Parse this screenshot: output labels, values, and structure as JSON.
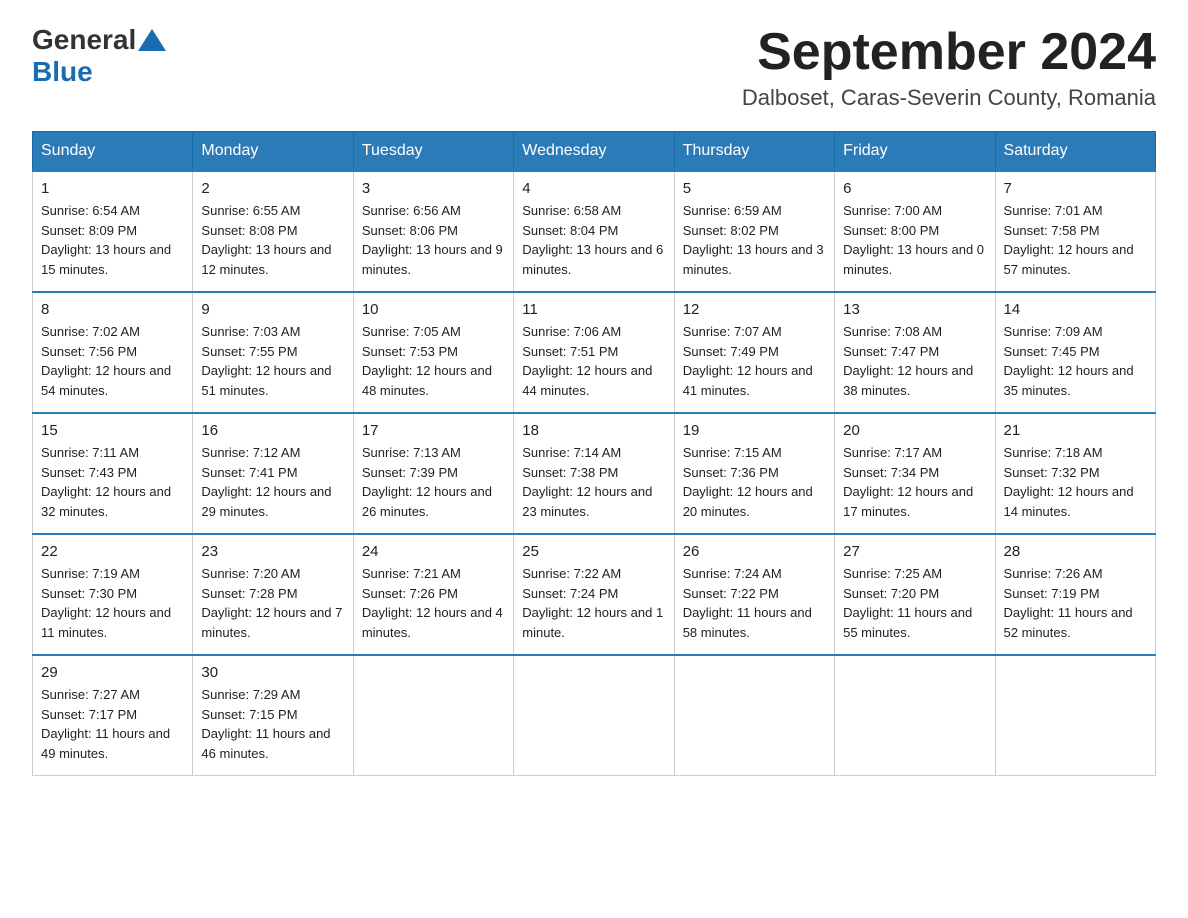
{
  "header": {
    "logo_general": "General",
    "logo_blue": "Blue",
    "month_title": "September 2024",
    "location": "Dalboset, Caras-Severin County, Romania"
  },
  "days_of_week": [
    "Sunday",
    "Monday",
    "Tuesday",
    "Wednesday",
    "Thursday",
    "Friday",
    "Saturday"
  ],
  "weeks": [
    [
      {
        "day": "1",
        "sunrise": "6:54 AM",
        "sunset": "8:09 PM",
        "daylight": "13 hours and 15 minutes."
      },
      {
        "day": "2",
        "sunrise": "6:55 AM",
        "sunset": "8:08 PM",
        "daylight": "13 hours and 12 minutes."
      },
      {
        "day": "3",
        "sunrise": "6:56 AM",
        "sunset": "8:06 PM",
        "daylight": "13 hours and 9 minutes."
      },
      {
        "day": "4",
        "sunrise": "6:58 AM",
        "sunset": "8:04 PM",
        "daylight": "13 hours and 6 minutes."
      },
      {
        "day": "5",
        "sunrise": "6:59 AM",
        "sunset": "8:02 PM",
        "daylight": "13 hours and 3 minutes."
      },
      {
        "day": "6",
        "sunrise": "7:00 AM",
        "sunset": "8:00 PM",
        "daylight": "13 hours and 0 minutes."
      },
      {
        "day": "7",
        "sunrise": "7:01 AM",
        "sunset": "7:58 PM",
        "daylight": "12 hours and 57 minutes."
      }
    ],
    [
      {
        "day": "8",
        "sunrise": "7:02 AM",
        "sunset": "7:56 PM",
        "daylight": "12 hours and 54 minutes."
      },
      {
        "day": "9",
        "sunrise": "7:03 AM",
        "sunset": "7:55 PM",
        "daylight": "12 hours and 51 minutes."
      },
      {
        "day": "10",
        "sunrise": "7:05 AM",
        "sunset": "7:53 PM",
        "daylight": "12 hours and 48 minutes."
      },
      {
        "day": "11",
        "sunrise": "7:06 AM",
        "sunset": "7:51 PM",
        "daylight": "12 hours and 44 minutes."
      },
      {
        "day": "12",
        "sunrise": "7:07 AM",
        "sunset": "7:49 PM",
        "daylight": "12 hours and 41 minutes."
      },
      {
        "day": "13",
        "sunrise": "7:08 AM",
        "sunset": "7:47 PM",
        "daylight": "12 hours and 38 minutes."
      },
      {
        "day": "14",
        "sunrise": "7:09 AM",
        "sunset": "7:45 PM",
        "daylight": "12 hours and 35 minutes."
      }
    ],
    [
      {
        "day": "15",
        "sunrise": "7:11 AM",
        "sunset": "7:43 PM",
        "daylight": "12 hours and 32 minutes."
      },
      {
        "day": "16",
        "sunrise": "7:12 AM",
        "sunset": "7:41 PM",
        "daylight": "12 hours and 29 minutes."
      },
      {
        "day": "17",
        "sunrise": "7:13 AM",
        "sunset": "7:39 PM",
        "daylight": "12 hours and 26 minutes."
      },
      {
        "day": "18",
        "sunrise": "7:14 AM",
        "sunset": "7:38 PM",
        "daylight": "12 hours and 23 minutes."
      },
      {
        "day": "19",
        "sunrise": "7:15 AM",
        "sunset": "7:36 PM",
        "daylight": "12 hours and 20 minutes."
      },
      {
        "day": "20",
        "sunrise": "7:17 AM",
        "sunset": "7:34 PM",
        "daylight": "12 hours and 17 minutes."
      },
      {
        "day": "21",
        "sunrise": "7:18 AM",
        "sunset": "7:32 PM",
        "daylight": "12 hours and 14 minutes."
      }
    ],
    [
      {
        "day": "22",
        "sunrise": "7:19 AM",
        "sunset": "7:30 PM",
        "daylight": "12 hours and 11 minutes."
      },
      {
        "day": "23",
        "sunrise": "7:20 AM",
        "sunset": "7:28 PM",
        "daylight": "12 hours and 7 minutes."
      },
      {
        "day": "24",
        "sunrise": "7:21 AM",
        "sunset": "7:26 PM",
        "daylight": "12 hours and 4 minutes."
      },
      {
        "day": "25",
        "sunrise": "7:22 AM",
        "sunset": "7:24 PM",
        "daylight": "12 hours and 1 minute."
      },
      {
        "day": "26",
        "sunrise": "7:24 AM",
        "sunset": "7:22 PM",
        "daylight": "11 hours and 58 minutes."
      },
      {
        "day": "27",
        "sunrise": "7:25 AM",
        "sunset": "7:20 PM",
        "daylight": "11 hours and 55 minutes."
      },
      {
        "day": "28",
        "sunrise": "7:26 AM",
        "sunset": "7:19 PM",
        "daylight": "11 hours and 52 minutes."
      }
    ],
    [
      {
        "day": "29",
        "sunrise": "7:27 AM",
        "sunset": "7:17 PM",
        "daylight": "11 hours and 49 minutes."
      },
      {
        "day": "30",
        "sunrise": "7:29 AM",
        "sunset": "7:15 PM",
        "daylight": "11 hours and 46 minutes."
      },
      null,
      null,
      null,
      null,
      null
    ]
  ],
  "labels": {
    "sunrise_prefix": "Sunrise: ",
    "sunset_prefix": "Sunset: ",
    "daylight_prefix": "Daylight: "
  }
}
